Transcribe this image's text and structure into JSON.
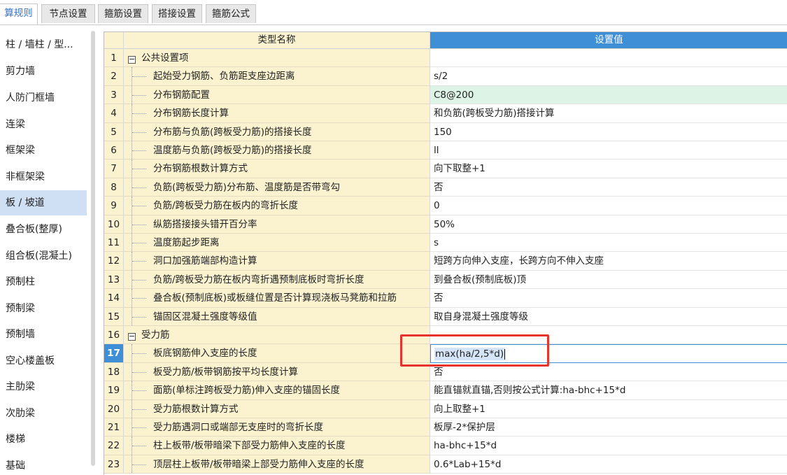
{
  "tabs": [
    {
      "label": "算规则",
      "active": true
    },
    {
      "label": "节点设置",
      "active": false
    },
    {
      "label": "箍筋设置",
      "active": false
    },
    {
      "label": "搭接设置",
      "active": false
    },
    {
      "label": "箍筋公式",
      "active": false
    }
  ],
  "sidebar": {
    "items": [
      {
        "label": "柱 / 墙柱 / 型..."
      },
      {
        "label": "剪力墙"
      },
      {
        "label": "人防门框墙"
      },
      {
        "label": "连梁"
      },
      {
        "label": "框架梁"
      },
      {
        "label": "非框架梁"
      },
      {
        "label": "板 / 坡道",
        "active": true
      },
      {
        "label": "叠合板(整厚)"
      },
      {
        "label": "组合板(混凝土)"
      },
      {
        "label": "预制柱"
      },
      {
        "label": "预制梁"
      },
      {
        "label": "预制墙"
      },
      {
        "label": "空心楼盖板"
      },
      {
        "label": "主肋梁"
      },
      {
        "label": "次肋梁"
      },
      {
        "label": "楼梯"
      },
      {
        "label": "基础"
      }
    ]
  },
  "grid": {
    "header": {
      "num": "",
      "name": "类型名称",
      "value": "设置值"
    },
    "rows": [
      {
        "num": "1",
        "name": "公共设置项",
        "value": "",
        "group": true,
        "toggle": "−"
      },
      {
        "num": "2",
        "name": "起始受力钢筋、负筋距支座边距离",
        "value": "s/2"
      },
      {
        "num": "3",
        "name": "分布钢筋配置",
        "value": "C8@200",
        "highlight": "green"
      },
      {
        "num": "4",
        "name": "分布钢筋长度计算",
        "value": "和负筋(跨板受力筋)搭接计算"
      },
      {
        "num": "5",
        "name": "分布筋与负筋(跨板受力筋)的搭接长度",
        "value": "150"
      },
      {
        "num": "6",
        "name": "温度筋与负筋(跨板受力筋)的搭接长度",
        "value": "ll"
      },
      {
        "num": "7",
        "name": "分布钢筋根数计算方式",
        "value": "向下取整+1"
      },
      {
        "num": "8",
        "name": "负筋(跨板受力筋)分布筋、温度筋是否带弯勾",
        "value": "否"
      },
      {
        "num": "9",
        "name": "负筋/跨板受力筋在板内的弯折长度",
        "value": "0"
      },
      {
        "num": "10",
        "name": "纵筋搭接接头错开百分率",
        "value": "50%"
      },
      {
        "num": "11",
        "name": "温度筋起步距离",
        "value": "s"
      },
      {
        "num": "12",
        "name": "洞口加强筋端部构造计算",
        "value": "短跨方向伸入支座，长跨方向不伸入支座"
      },
      {
        "num": "13",
        "name": "负筋/跨板受力筋在板内弯折遇预制底板时弯折长度",
        "value": "到叠合板(预制底板)顶"
      },
      {
        "num": "14",
        "name": "叠合板(预制底板)或板缝位置是否计算现浇板马凳筋和拉筋",
        "value": "否"
      },
      {
        "num": "15",
        "name": "锚固区混凝土强度等级值",
        "value": "取自身混凝土强度等级"
      },
      {
        "num": "16",
        "name": "受力筋",
        "value": "",
        "group": true,
        "toggle": "−"
      },
      {
        "num": "17",
        "name": "板底钢筋伸入支座的长度",
        "value": "max(ha/2,5*d)",
        "selected": true
      },
      {
        "num": "18",
        "name": "板受力筋/板带钢筋按平均长度计算",
        "value": "否"
      },
      {
        "num": "19",
        "name": "面筋(单标注跨板受力筋)伸入支座的锚固长度",
        "value": "能直锚就直锚,否则按公式计算:ha-bhc+15*d"
      },
      {
        "num": "20",
        "name": "受力筋根数计算方式",
        "value": "向上取整+1"
      },
      {
        "num": "21",
        "name": "受力筋遇洞口或端部无支座时的弯折长度",
        "value": "板厚-2*保护层"
      },
      {
        "num": "22",
        "name": "柱上板带/板带暗梁下部受力筋伸入支座的长度",
        "value": "ha-bhc+15*d"
      },
      {
        "num": "23",
        "name": "顶层柱上板带/板带暗梁上部受力筋伸入支座的长度",
        "value": "0.6*Lab+15*d"
      }
    ]
  },
  "colors": {
    "header_value_bg": "#3e8fd6",
    "name_column_bg": "#fbf3d0",
    "active_tab_text": "#3b74c4",
    "sidebar_active_bg": "#cfe0f5",
    "green_highlight": "#dcf3e6",
    "annotation_red": "#e8322c"
  }
}
